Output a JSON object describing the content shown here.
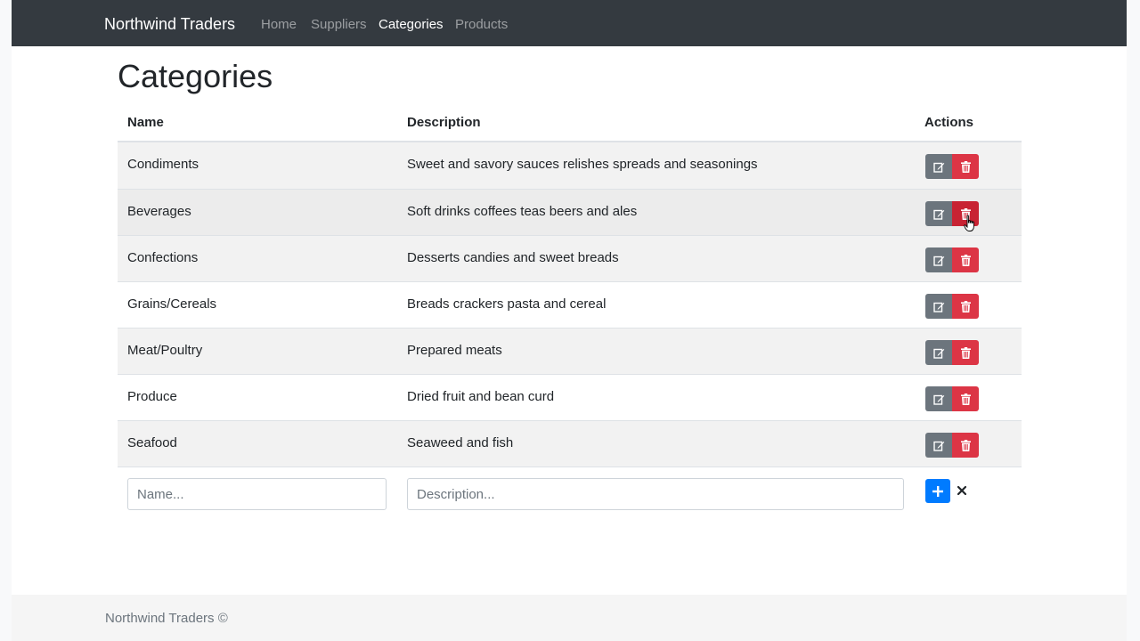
{
  "navbar": {
    "brand": "Northwind Traders",
    "links": [
      {
        "label": "Home",
        "active": false
      },
      {
        "label": "Suppliers",
        "active": false
      },
      {
        "label": "Categories",
        "active": true
      },
      {
        "label": "Products",
        "active": false
      }
    ]
  },
  "page": {
    "title": "Categories"
  },
  "table": {
    "headers": {
      "name": "Name",
      "description": "Description",
      "actions": "Actions"
    },
    "rows": [
      {
        "name": "Condiments",
        "description": "Sweet and savory sauces relishes spreads and seasonings"
      },
      {
        "name": "Beverages",
        "description": "Soft drinks coffees teas beers and ales"
      },
      {
        "name": "Confections",
        "description": "Desserts candies and sweet breads"
      },
      {
        "name": "Grains/Cereals",
        "description": "Breads crackers pasta and cereal"
      },
      {
        "name": "Meat/Poultry",
        "description": "Prepared meats"
      },
      {
        "name": "Produce",
        "description": "Dried fruit and bean curd"
      },
      {
        "name": "Seafood",
        "description": "Seaweed and fish"
      }
    ],
    "row_icons": {
      "edit": "edit-icon",
      "delete": "trash-icon"
    }
  },
  "add_form": {
    "name_placeholder": "Name...",
    "description_placeholder": "Description...",
    "name_value": "",
    "description_value": "",
    "add_icon": "plus-icon",
    "cancel_icon": "close-icon"
  },
  "footer": {
    "text": "Northwind Traders ©"
  },
  "colors": {
    "navbar_bg": "#343a40",
    "edit_button": "#6c757d",
    "delete_button": "#dc3545",
    "add_button": "#007bff",
    "footer_bg": "#f5f5f5"
  }
}
